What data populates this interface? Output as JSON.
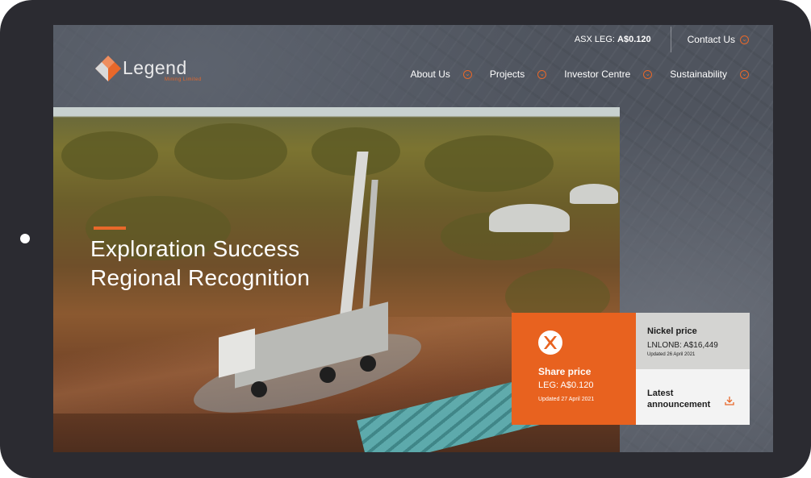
{
  "topbar": {
    "ticker_prefix": "ASX LEG: ",
    "ticker_value": "A$0.120",
    "contact_label": "Contact Us"
  },
  "logo": {
    "name": "Legend",
    "subtitle": "Mining Limited"
  },
  "nav": {
    "items": [
      {
        "label": "About Us"
      },
      {
        "label": "Projects"
      },
      {
        "label": "Investor Centre"
      },
      {
        "label": "Sustainability"
      }
    ]
  },
  "hero": {
    "title_line1": "Exploration Success",
    "title_line2": "Regional Recognition"
  },
  "share": {
    "title": "Share price",
    "value": "LEG: A$0.120",
    "updated": "Updated 27 April 2021"
  },
  "nickel": {
    "title": "Nickel price",
    "value": "LNLONB: A$16,449",
    "updated": "Updated 26 April 2021"
  },
  "announcement": {
    "label": "Latest announcement"
  },
  "colors": {
    "accent": "#e8682a",
    "share_bg": "#e8621f",
    "device": "#2b2b31"
  }
}
